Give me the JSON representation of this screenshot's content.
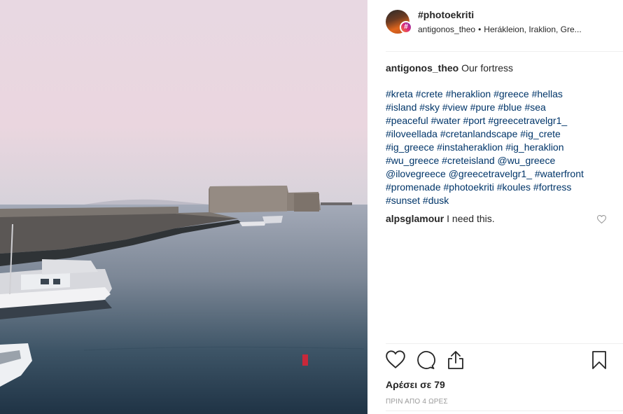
{
  "post": {
    "account": "#photoekriti",
    "author": "antigonos_theo",
    "location": "Herákleion, Iraklion, Gre...",
    "caption": "Our fortress",
    "hashtag_lines": [
      "#kreta #crete #heraklion #greece #hellas",
      "#island #sky #view #pure #blue #sea",
      "#peaceful #water #port #greecetravelgr1_",
      "#iloveellada #cretanlandscape #ig_crete",
      "#ig_greece #instaheraklion #ig_heraklion",
      "#wu_greece #creteisland @wu_greece",
      "@ilovegreece @greecetravelgr1_ #waterfront",
      "#promenade #photoekriti #koules #fortress",
      "#sunset #dusk"
    ],
    "comment": {
      "user": "alpsglamour",
      "text": "I need this."
    },
    "likes_label": "Αρέσει σε 79",
    "time_ago": "ΠΡΙΝ ΑΠΟ 4 ΩΡΕΣ"
  },
  "icons": {
    "like": "heart-icon",
    "comment": "comment-icon",
    "share": "share-icon",
    "save": "bookmark-icon",
    "comment_like": "heart-small-icon",
    "avatar_badge": "hashtag-badge-icon"
  },
  "colors": {
    "text": "#262626",
    "hashtag": "#003569",
    "muted": "#999999",
    "divider": "#efefef"
  }
}
